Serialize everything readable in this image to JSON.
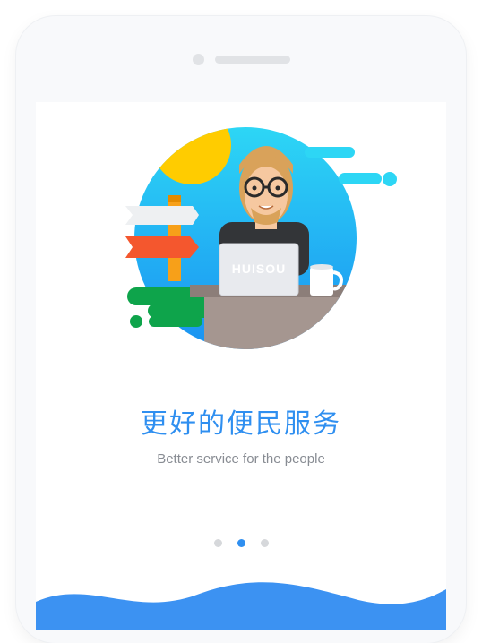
{
  "onboarding": {
    "title": "更好的便民服务",
    "subtitle": "Better service for the people",
    "page_indicator": {
      "count": 3,
      "active_index": 1
    }
  },
  "illustration": {
    "laptop_logo_text": "HUISOU"
  },
  "colors": {
    "accent": "#2f8ff0",
    "wave": "#3c92f2",
    "sun": "#ffcc00",
    "sky_top": "#2dd6f5",
    "sky_bottom": "#1a92f2",
    "signpost_red": "#f4572e",
    "grass": "#0ea44b"
  }
}
